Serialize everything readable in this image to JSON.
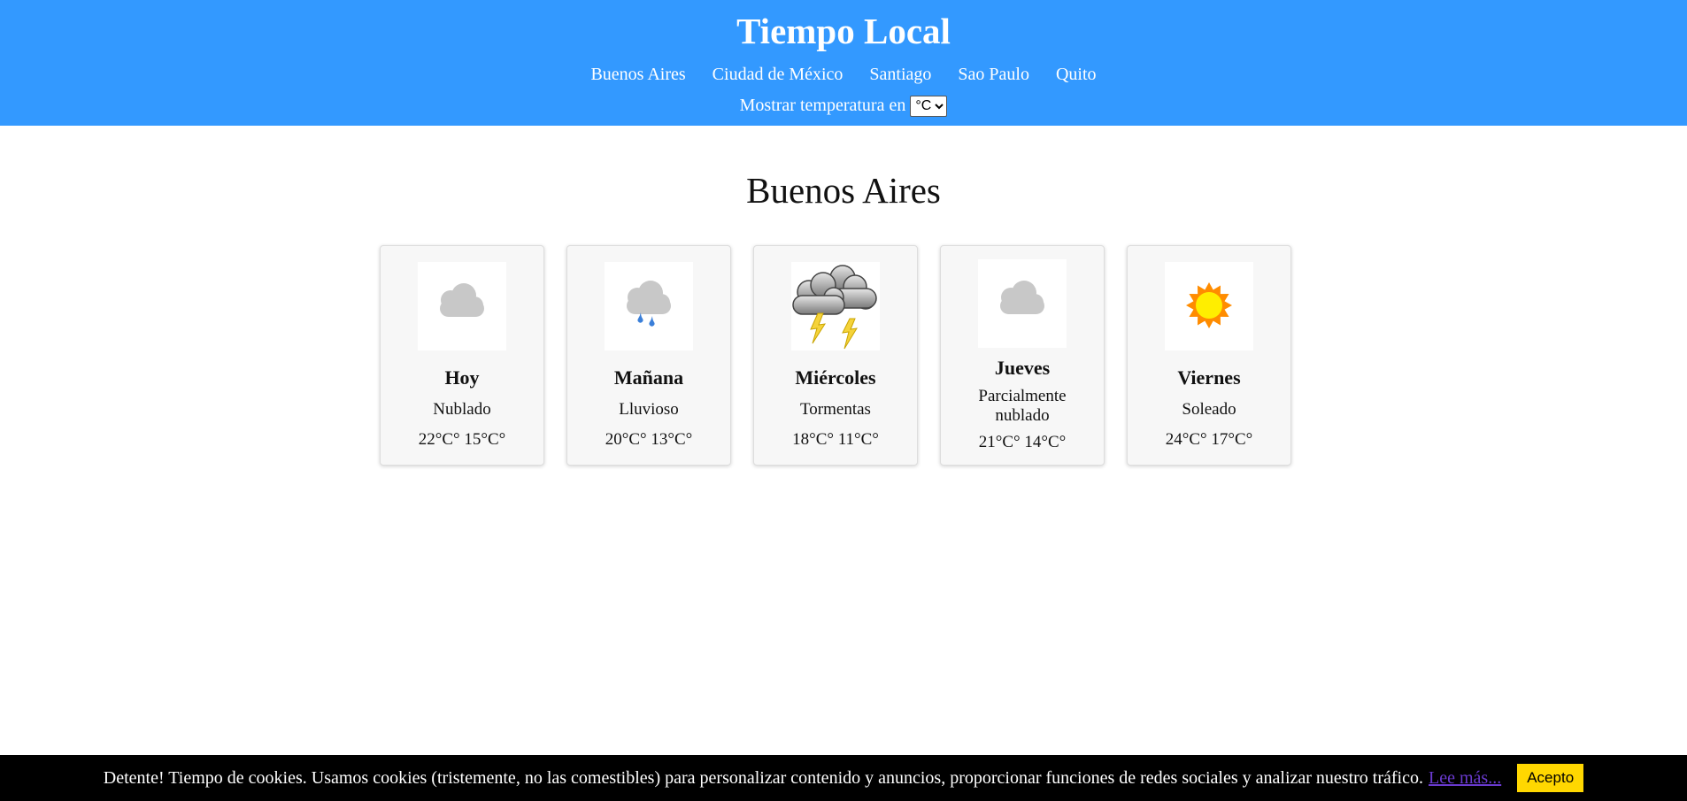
{
  "header": {
    "title": "Tiempo Local",
    "nav": [
      "Buenos Aires",
      "Ciudad de México",
      "Santiago",
      "Sao Paulo",
      "Quito"
    ],
    "unit_label": "Mostrar temperatura en",
    "unit_selected": "°C"
  },
  "city": "Buenos Aires",
  "forecast": [
    {
      "day": "Hoy",
      "condition": "Nublado",
      "temps": "22°C° 15°C°",
      "icon": "cloud-icon"
    },
    {
      "day": "Mañana",
      "condition": "Lluvioso",
      "temps": "20°C° 13°C°",
      "icon": "rain-icon"
    },
    {
      "day": "Miércoles",
      "condition": "Tormentas",
      "temps": "18°C° 11°C°",
      "icon": "storm-icon"
    },
    {
      "day": "Jueves",
      "condition": "Parcialmente nublado",
      "temps": "21°C° 14°C°",
      "icon": "cloud-icon"
    },
    {
      "day": "Viernes",
      "condition": "Soleado",
      "temps": "24°C° 17°C°",
      "icon": "sun-icon"
    }
  ],
  "cookie": {
    "message": "Detente! Tiempo de cookies. Usamos cookies (tristemente, no las comestibles) para personalizar contenido y anuncios, proporcionar funciones de redes sociales y analizar nuestro tráfico.",
    "link": "Lee más...",
    "accept": "Acepto"
  },
  "colors": {
    "header_bg": "#3399ff",
    "accept_bg": "#ffd700",
    "link": "#6a3ad0"
  }
}
